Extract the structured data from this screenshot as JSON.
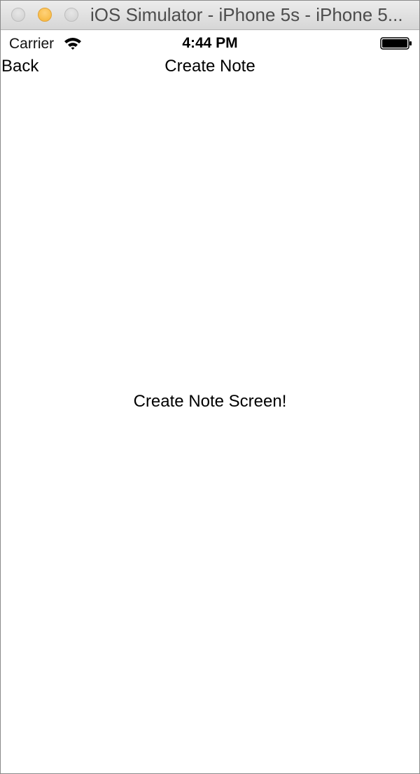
{
  "window": {
    "title": "iOS Simulator - iPhone 5s - iPhone 5..."
  },
  "status_bar": {
    "carrier": "Carrier",
    "time": "4:44 PM",
    "icons": [
      "wifi-icon",
      "battery-icon"
    ]
  },
  "nav_bar": {
    "back_label": "Back",
    "title": "Create Note"
  },
  "content": {
    "message": "Create Note Screen!"
  },
  "colors": {
    "minimize_button": "#f5b335",
    "inactive_button": "#cfcfcf",
    "text": "#000000",
    "background": "#ffffff"
  }
}
